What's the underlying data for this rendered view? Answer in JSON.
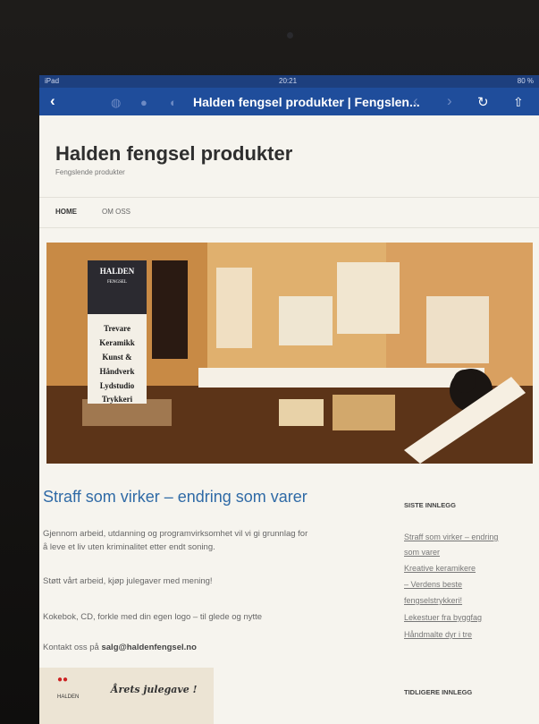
{
  "status_bar": {
    "device": "iPad",
    "time": "20:21",
    "battery": "80 %"
  },
  "browser": {
    "back_icon": "chevron-left-icon",
    "tab_title": "Halden fengsel produkter | Fengslen...",
    "reload_icon": "reload-icon",
    "share_icon": "share-icon"
  },
  "site": {
    "title": "Halden fengsel produkter",
    "tagline": "Fengslende produkter"
  },
  "menu": {
    "items": [
      "HOME",
      "OM OSS"
    ]
  },
  "hero": {
    "sign_lines": [
      "HALDEN",
      "FENGSEL"
    ],
    "sign_items": [
      "Trevare",
      "Keramikk",
      "Kunst &",
      "Håndverk",
      "Lydstudio",
      "Trykkeri"
    ]
  },
  "post": {
    "title": "Straff som virker – endring som varer",
    "p1_line1": "Gjennom arbeid, utdanning og programvirksomhet vil vi gi grunnlag for",
    "p1_line2": "å leve et liv uten kriminalitet etter endt soning.",
    "p2": "Støtt vårt arbeid, kjøp julegaver med mening!",
    "p3": "Kokebok, CD, forkle med din egen logo – til glede og nytte",
    "p4_prefix": "Kontakt oss på ",
    "p4_email": "salg@haldenfengsel.no",
    "card_title": "Årets julegave !",
    "card_brand": "HALDEN"
  },
  "sidebar": {
    "recent_heading": "SISTE INNLEGG",
    "recent_lines": [
      "Straff som virker – endring",
      "som varer",
      "Kreative keramikere",
      "– Verdens beste",
      "fengselstrykkeri!",
      "Lekestuer fra byggfag",
      "Håndmalte dyr i tre"
    ],
    "older_heading": "TIDLIGERE INNLEGG"
  }
}
